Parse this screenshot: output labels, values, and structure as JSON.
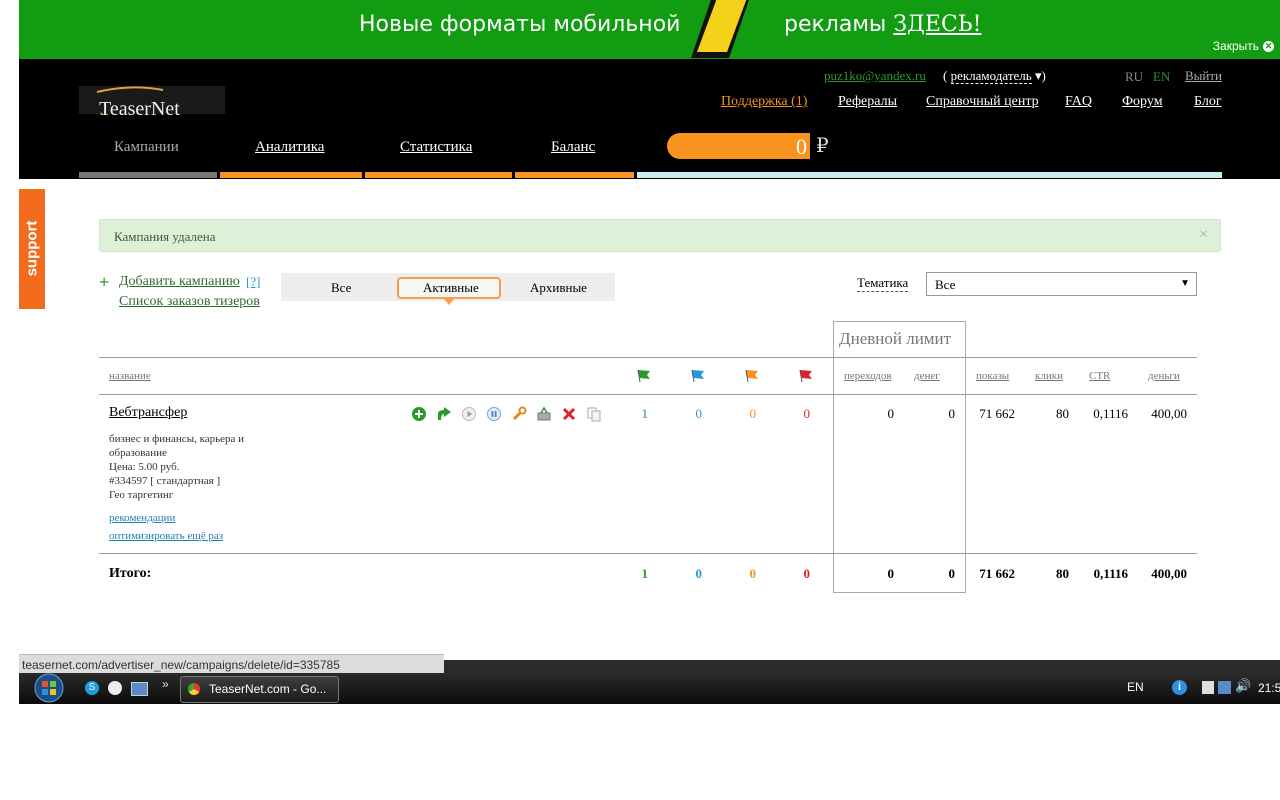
{
  "banner": {
    "text1": "Новые форматы мобильной",
    "text2": "рекламы",
    "link": "ЗДЕСЬ!",
    "close": "Закрыть"
  },
  "header": {
    "logo": "TeaserNet",
    "logo_dot": ".",
    "email": "puz1ko@yandex.ru",
    "role": "рекламодатель",
    "lang_ru": "RU",
    "lang_en": "EN",
    "logout": "Выйти",
    "links": [
      "Поддержка (1)",
      "Рефералы",
      "Справочный центр",
      "FAQ",
      "Форум",
      "Блог"
    ],
    "tabs": [
      "Кампании",
      "Аналитика",
      "Статистика",
      "Баланс"
    ],
    "balance": "0",
    "currency": "₽"
  },
  "support": "support",
  "alert": {
    "text": "Кампания удалена",
    "close": "×"
  },
  "actions": {
    "add": "Добавить кампанию",
    "help": "[?]",
    "orders": "Список заказов тизеров"
  },
  "filters": {
    "all": "Все",
    "active": "Активные",
    "archive": "Архивные"
  },
  "topic": {
    "label": "Тематика",
    "value": "Все"
  },
  "table": {
    "group_header": "Дневной лимит",
    "headers": {
      "name": "название",
      "transitions": "переходов",
      "money_limit": "денег",
      "shows": "показы",
      "clicks": "клики",
      "ctr": "CTR",
      "money": "деньги"
    },
    "row": {
      "name": "Вебтрансфер",
      "desc1": "бизнес и финансы, карьера и",
      "desc2": "образование",
      "price": "Цена: 5.00 руб.",
      "id": "#334597 [ стандартная ]",
      "geo": "Гео таргетинг",
      "link1": "рекомендации",
      "link2": "оптимизировать ещё раз",
      "green": "1",
      "blue": "0",
      "orange": "0",
      "red": "0",
      "transitions": "0",
      "money_limit": "0",
      "shows": "71 662",
      "clicks": "80",
      "ctr": "0,1116",
      "money": "400,00"
    },
    "total": {
      "label": "Итого:",
      "green": "1",
      "blue": "0",
      "orange": "0",
      "red": "0",
      "transitions": "0",
      "money_limit": "0",
      "shows": "71 662",
      "clicks": "80",
      "ctr": "0,1116",
      "money": "400,00"
    }
  },
  "statusbar": "teasernet.com/advertiser_new/campaigns/delete/id=335785",
  "taskbar": {
    "tab": "TeaserNet.com - Go...",
    "lang": "EN",
    "time": "21:5"
  },
  "colors": {
    "banner": "#129c12",
    "orange": "#f7931e",
    "green": "#2a9b2a",
    "blue": "#1e9ad6",
    "red": "#d9252a"
  }
}
